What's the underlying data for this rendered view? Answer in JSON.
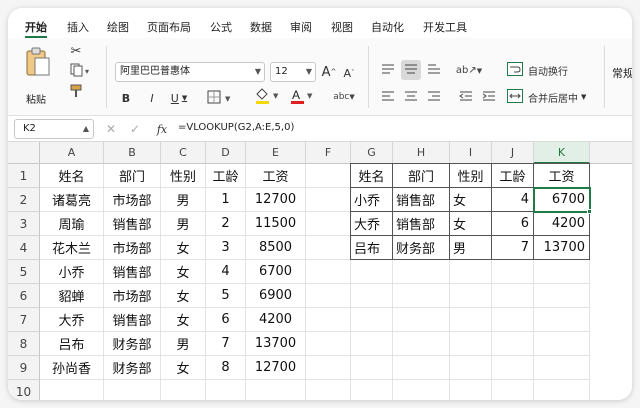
{
  "tabs": [
    "开始",
    "插入",
    "绘图",
    "页面布局",
    "公式",
    "数据",
    "审阅",
    "视图",
    "自动化",
    "开发工具"
  ],
  "ribbon": {
    "paste_label": "粘贴",
    "font_name": "阿里巴巴普惠体",
    "font_size": "12",
    "grow_font": "A",
    "shrink_font": "A",
    "bold": "B",
    "italic": "I",
    "underline": "U",
    "wrap_text": "自动换行",
    "merge_center": "合并后居中",
    "number_format": "常规",
    "accent_color": "#1f7a45",
    "fill_color": "#f5d800",
    "font_color": "#e02020"
  },
  "formula_bar": {
    "name_box": "K2",
    "fx": "fx",
    "formula": "=VLOOKUP(G2,A:E,5,0)"
  },
  "sheet": {
    "columns": [
      "A",
      "B",
      "C",
      "D",
      "E",
      "F",
      "G",
      "H",
      "I",
      "J",
      "K"
    ],
    "selected_column": "K",
    "rows": [
      "1",
      "2",
      "3",
      "4",
      "5",
      "6",
      "7",
      "8",
      "9",
      "10"
    ],
    "selected_cell": "K2",
    "left_table": [
      [
        "姓名",
        "部门",
        "性别",
        "工龄",
        "工资"
      ],
      [
        "诸葛亮",
        "市场部",
        "男",
        "1",
        "12700"
      ],
      [
        "周瑜",
        "销售部",
        "男",
        "2",
        "11500"
      ],
      [
        "花木兰",
        "市场部",
        "女",
        "3",
        "8500"
      ],
      [
        "小乔",
        "销售部",
        "女",
        "4",
        "6700"
      ],
      [
        "貂蝉",
        "市场部",
        "女",
        "5",
        "6900"
      ],
      [
        "大乔",
        "销售部",
        "女",
        "6",
        "4200"
      ],
      [
        "吕布",
        "财务部",
        "男",
        "7",
        "13700"
      ],
      [
        "孙尚香",
        "财务部",
        "女",
        "8",
        "12700"
      ]
    ],
    "right_table": [
      [
        "姓名",
        "部门",
        "性别",
        "工龄",
        "工资"
      ],
      [
        "小乔",
        "销售部",
        "女",
        "4",
        "6700"
      ],
      [
        "大乔",
        "销售部",
        "女",
        "6",
        "4200"
      ],
      [
        "吕布",
        "财务部",
        "男",
        "7",
        "13700"
      ]
    ]
  }
}
